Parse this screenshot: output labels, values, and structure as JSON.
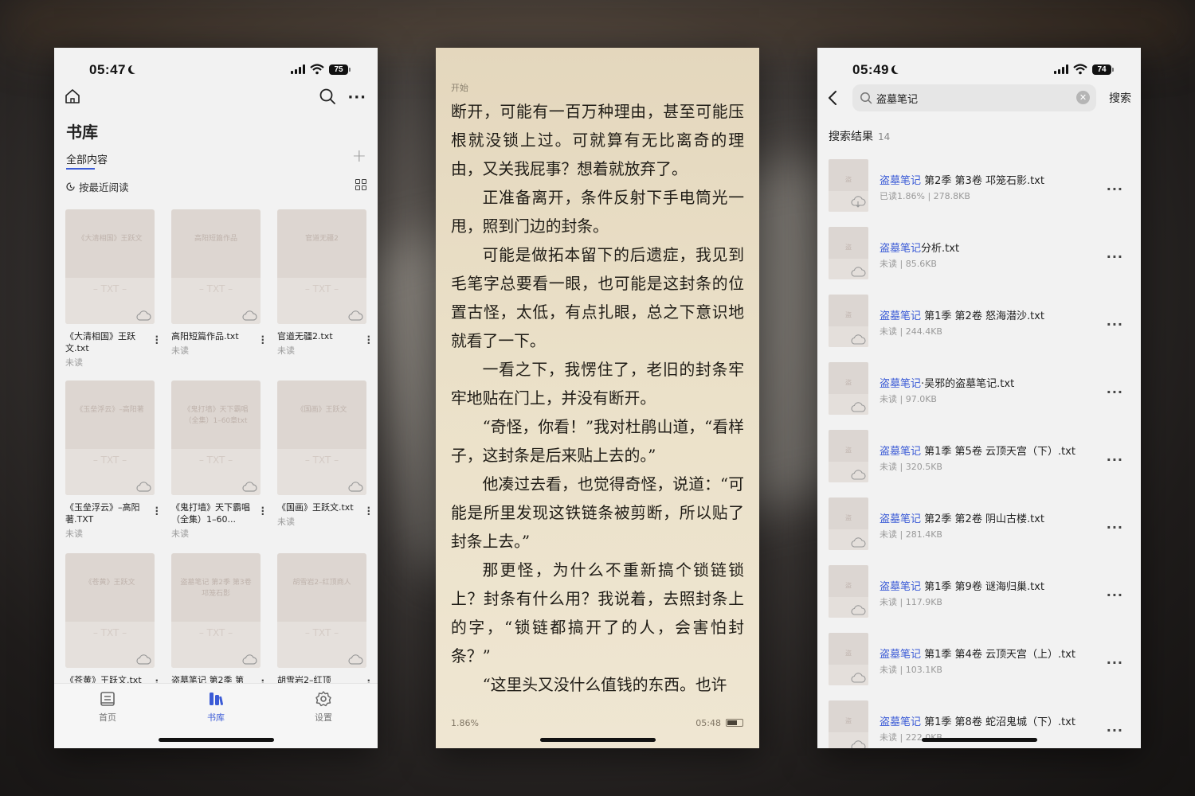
{
  "library": {
    "status": {
      "time": "05:47",
      "battery": "75"
    },
    "title": "书库",
    "tab_all": "全部内容",
    "sort_label": "按最近阅读",
    "books": [
      {
        "cover_title": "《大清相国》王跃文",
        "cover_type": "– TXT –",
        "name": "《大清相国》王跃文.txt",
        "status": "未读"
      },
      {
        "cover_title": "高阳短篇作品",
        "cover_type": "– TXT –",
        "name": "高阳短篇作品.txt",
        "status": "未读"
      },
      {
        "cover_title": "官道无疆2",
        "cover_type": "– TXT –",
        "name": "官道无疆2.txt",
        "status": "未读"
      },
      {
        "cover_title": "《玉垒浮云》–高阳著",
        "cover_type": "– TXT –",
        "name": "《玉垒浮云》–高阳 著.TXT",
        "status": "未读"
      },
      {
        "cover_title": "《鬼打墙》天下霸唱（全集）1–60章txt",
        "cover_type": "– TXT –",
        "name": "《鬼打墙》天下霸唱（全集）1–60...",
        "status": "未读"
      },
      {
        "cover_title": "《国画》王跃文",
        "cover_type": "– TXT –",
        "name": "《国画》王跃文.txt",
        "status": "未读"
      },
      {
        "cover_title": "《苍黄》王跃文",
        "cover_type": "– TXT –",
        "name": "《苍黄》王跃文.txt",
        "status": ""
      },
      {
        "cover_title": "盗墓笔记 第2季 第3卷 邛笼石影",
        "cover_type": "– TXT –",
        "name": "盗墓笔记 第2季 第",
        "status": ""
      },
      {
        "cover_title": "胡雪岩2–红顶商人",
        "cover_type": "– TXT –",
        "name": "胡雪岩2–红顶",
        "status": ""
      }
    ],
    "tabbar": {
      "home": "首页",
      "library": "书库",
      "settings": "设置"
    }
  },
  "reader": {
    "chapter": "开始",
    "paragraphs": [
      {
        "indent": false,
        "text": "断开，可能有一百万种理由，甚至可能压根就没锁上过。可就算有无比离奇的理由，又关我屁事？想着就放弃了。"
      },
      {
        "indent": true,
        "text": "正准备离开，条件反射下手电筒光一甩，照到门边的封条。"
      },
      {
        "indent": true,
        "text": "可能是做拓本留下的后遗症，我见到毛笔字总要看一眼，也可能是这封条的位置古怪，太低，有点扎眼，总之下意识地就看了一下。"
      },
      {
        "indent": true,
        "text": "一看之下，我愣住了，老旧的封条牢牢地贴在门上，并没有断开。"
      },
      {
        "indent": true,
        "text": "“奇怪，你看！”我对杜鹃山道，“看样子，这封条是后来贴上去的。”"
      },
      {
        "indent": true,
        "text": "他凑过去看，也觉得奇怪，说道：“可能是所里发现这铁链条被剪断，所以贴了封条上去。”"
      },
      {
        "indent": true,
        "text": "那更怪，为什么不重新搞个锁链锁上？封条有什么用？我说着，去照封条上的字，“锁链都搞开了的人，会害怕封条？”"
      },
      {
        "indent": true,
        "text": "“这里头又没什么值钱的东西。也许"
      }
    ],
    "progress": "1.86%",
    "clock": "05:48"
  },
  "search": {
    "status": {
      "time": "05:49",
      "battery": "74"
    },
    "query": "盗墓笔记",
    "submit": "搜索",
    "results_label": "搜索结果",
    "results_count": "14",
    "results": [
      {
        "highlight": "盗墓笔记",
        "rest": " 第2季 第3卷 邛笼石影.txt",
        "meta": "已读1.86% | 278.8KB"
      },
      {
        "highlight": "盗墓笔记",
        "rest": "分析.txt",
        "meta": "未读 | 85.6KB"
      },
      {
        "highlight": "盗墓笔记",
        "rest": " 第1季 第2卷 怒海潜沙.txt",
        "meta": "未读 | 244.4KB"
      },
      {
        "highlight": "盗墓笔记",
        "rest": "·吴邪的盗墓笔记.txt",
        "meta": "未读 | 97.0KB"
      },
      {
        "highlight": "盗墓笔记",
        "rest": " 第1季 第5卷 云顶天宫（下）.txt",
        "meta": "未读 | 320.5KB"
      },
      {
        "highlight": "盗墓笔记",
        "rest": " 第2季 第2卷 阴山古楼.txt",
        "meta": "未读 | 281.4KB"
      },
      {
        "highlight": "盗墓笔记",
        "rest": " 第1季 第9卷 谜海归巢.txt",
        "meta": "未读 | 117.9KB"
      },
      {
        "highlight": "盗墓笔记",
        "rest": " 第1季 第4卷 云顶天宫（上）.txt",
        "meta": "未读 | 103.1KB"
      },
      {
        "highlight": "盗墓笔记",
        "rest": " 第1季 第8卷 蛇沼鬼城（下）.txt",
        "meta": "未读 | 222.0KB"
      }
    ]
  },
  "colors": {
    "accent": "#3b5bd6",
    "reader_bg": "#e8dcc3",
    "app_bg": "#f2f2f2"
  }
}
